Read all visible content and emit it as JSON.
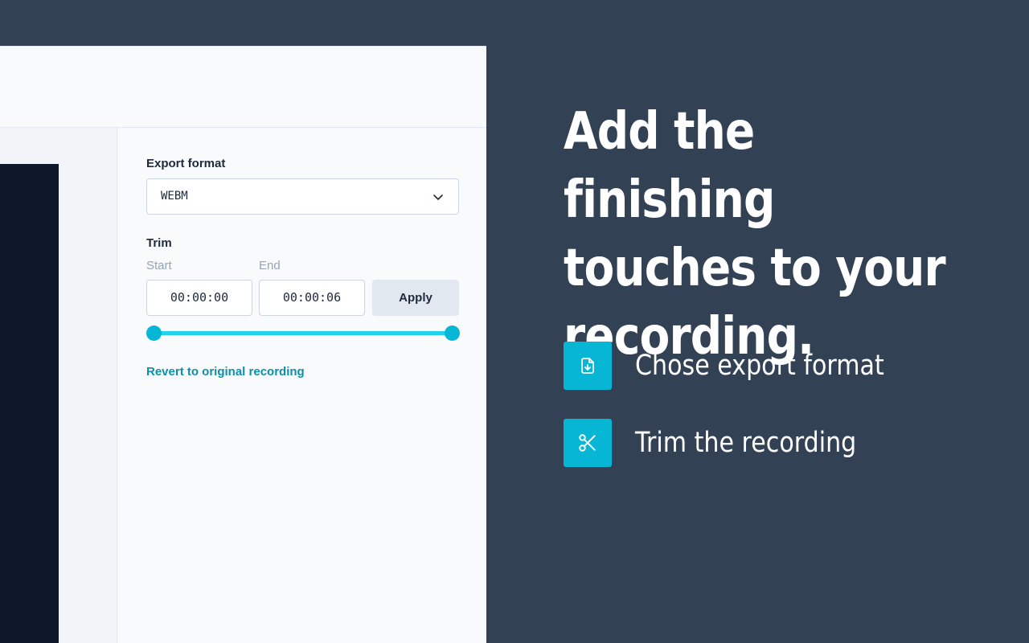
{
  "headline": "Add the finishing touches to your recording.",
  "features": [
    {
      "label": "Chose export format",
      "icon": "file-download-icon"
    },
    {
      "label": "Trim the recording",
      "icon": "scissors-icon"
    }
  ],
  "settings": {
    "export_format_label": "Export format",
    "export_format_value": "WEBM",
    "trim_label": "Trim",
    "start_label": "Start",
    "end_label": "End",
    "start_value": "00:00:00",
    "end_value": "00:00:06",
    "apply_label": "Apply",
    "revert_label": "Revert to original recording",
    "trim_range": [
      0,
      1
    ]
  },
  "colors": {
    "background": "#334155",
    "accent": "#06b6d4",
    "link": "#0e8fa8"
  }
}
